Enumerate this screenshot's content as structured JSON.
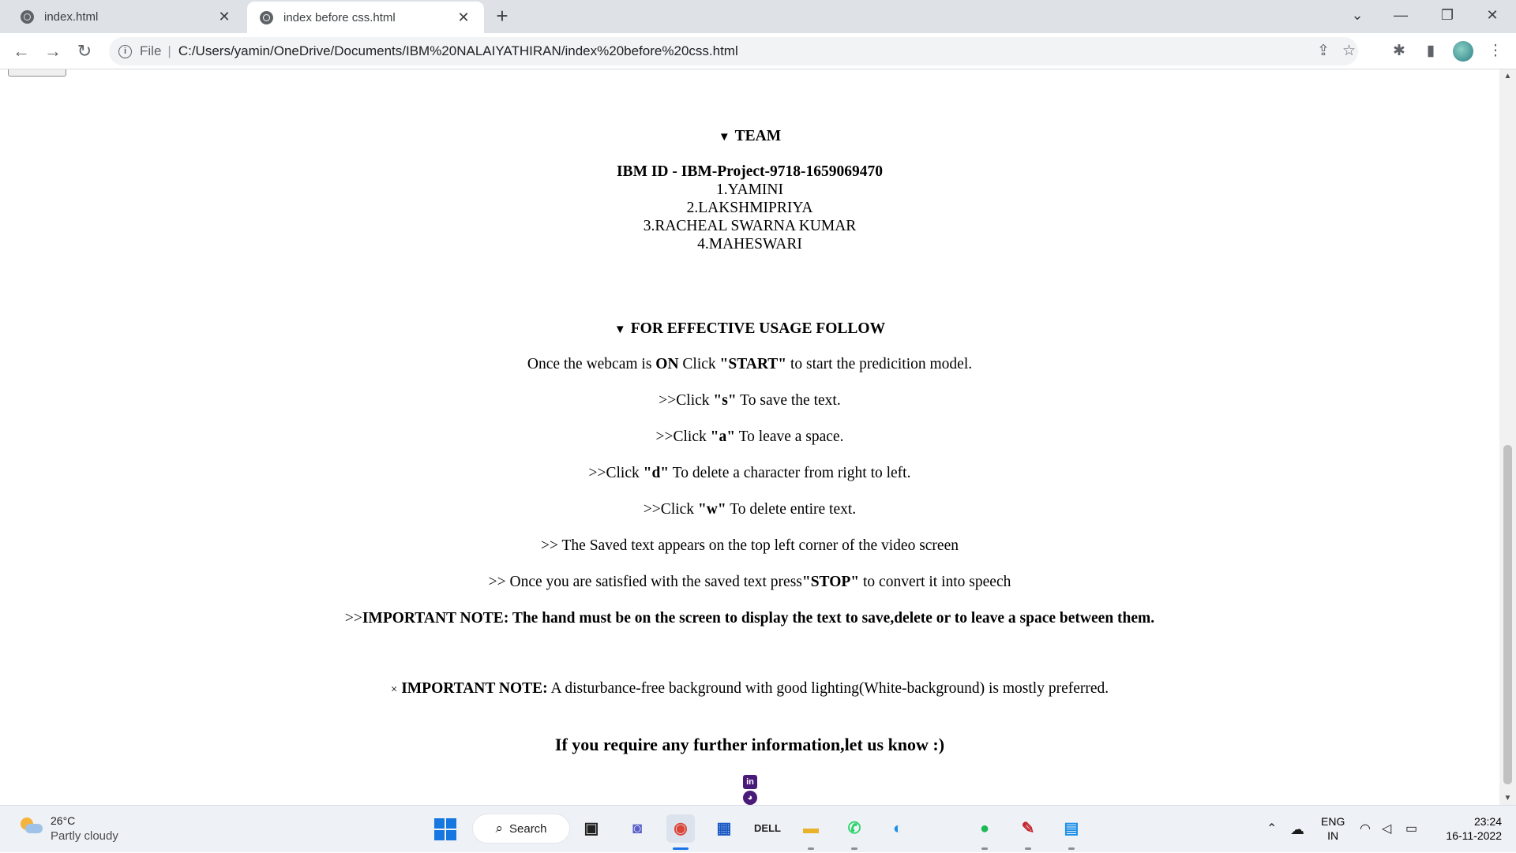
{
  "browser": {
    "tabs": [
      {
        "title": "index.html",
        "active": false
      },
      {
        "title": "index before css.html",
        "active": true
      }
    ],
    "new_tab_label": "+",
    "address": {
      "scheme_label": "File",
      "url": "C:/Users/yamin/OneDrive/Documents/IBM%20NALAIYATHIRAN/index%20before%20css.html"
    }
  },
  "page": {
    "team_summary": "TEAM",
    "ibm_id": "IBM ID - IBM-Project-9718-1659069470",
    "members": [
      "1.YAMINI",
      "2.LAKSHMIPRIYA",
      "3.RACHEAL SWARNA KUMAR",
      "4.MAHESWARI"
    ],
    "usage_summary": "FOR EFFECTIVE USAGE FOLLOW",
    "usage_intro": {
      "pre": "Once the webcam is ",
      "on": "ON",
      "mid": " Click ",
      "start": "\"START\"",
      "post": " to start the predicition model."
    },
    "instructions": [
      {
        "pre": ">>Click ",
        "key": "\"s\"",
        "post": " To save the text."
      },
      {
        "pre": ">>Click ",
        "key": "\"a\"",
        "post": " To leave a space."
      },
      {
        "pre": ">>Click ",
        "key": "\"d\"",
        "post": " To delete a character from right to left."
      },
      {
        "pre": ">>Click ",
        "key": "\"w\"",
        "post": " To delete entire text."
      }
    ],
    "saved_text_note": ">> The Saved text appears on the top left corner of the video screen",
    "stop_line": {
      "pre": ">> Once you are satisfied with the saved text press",
      "stop": "\"STOP\"",
      "post": " to convert it into speech"
    },
    "important_note_1": {
      "prefix": ">>",
      "text": "IMPORTANT NOTE: The hand must be on the screen to display the text to save,delete or to leave a space between them."
    },
    "important_note_2": {
      "close_glyph": "×",
      "label": "IMPORTANT NOTE:",
      "text": " A disturbance-free background with good lighting(White-background) is mostly preferred."
    },
    "contact_heading": "If you require any further information,let us know :)",
    "social_icons": [
      "linkedin-icon",
      "github-icon"
    ]
  },
  "taskbar": {
    "weather": {
      "temp": "26°C",
      "desc": "Partly cloudy"
    },
    "search_label": "Search",
    "lang": {
      "line1": "ENG",
      "line2": "IN"
    },
    "clock": {
      "time": "23:24",
      "date": "16-11-2022"
    }
  }
}
